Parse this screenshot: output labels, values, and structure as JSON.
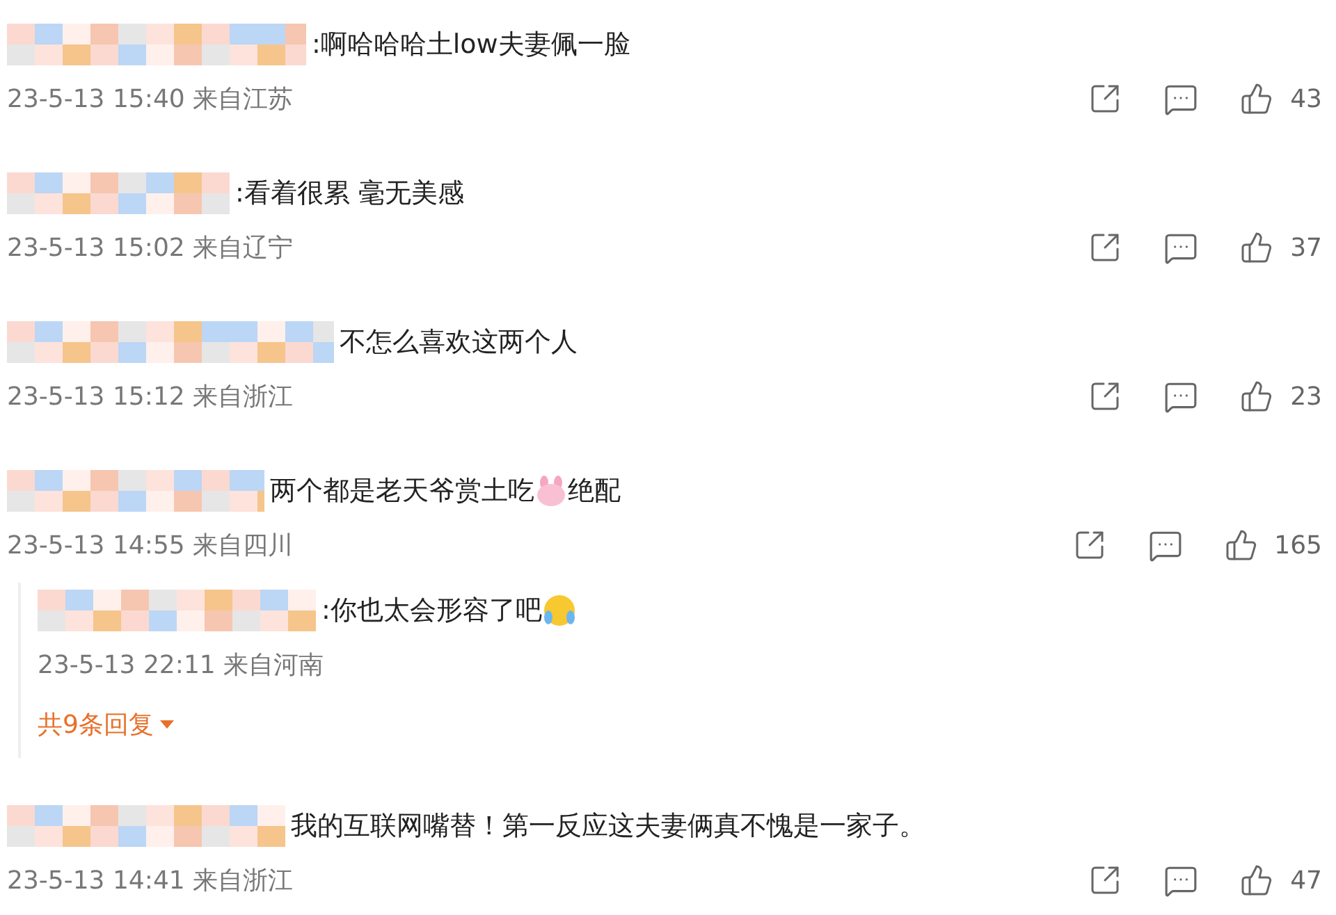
{
  "comments": [
    {
      "content": [
        {
          "kind": "text",
          "text": ":啊哈哈哈土low夫妻佩一脸"
        }
      ],
      "meta": "23-5-13 15:40 来自江苏",
      "likes": "43"
    },
    {
      "content": [
        {
          "kind": "text",
          "text": ":看着很累 毫无美感"
        }
      ],
      "meta": "23-5-13 15:02 来自辽宁",
      "likes": "37"
    },
    {
      "content": [
        {
          "kind": "text",
          "text": "不怎么喜欢这两个人"
        }
      ],
      "meta": "23-5-13 15:12 来自浙江",
      "likes": "23"
    },
    {
      "content": [
        {
          "kind": "text",
          "text": "两个都是老天爷赏土吃"
        },
        {
          "kind": "bunny"
        },
        {
          "kind": "text",
          "text": "绝配"
        }
      ],
      "meta": "23-5-13 14:55 来自四川",
      "likes": "165",
      "reply": {
        "content": [
          {
            "kind": "text",
            "text": ":你也太会形容了吧"
          },
          {
            "kind": "laugh"
          }
        ],
        "meta": "23-5-13 22:11 来自河南"
      },
      "more": "共9条回复"
    },
    {
      "content": [
        {
          "kind": "text",
          "text": "我的互联网嘴替！第一反应这夫妻俩真不愧是一家子。"
        }
      ],
      "meta": "23-5-13 14:41 来自浙江",
      "likes": "47"
    }
  ]
}
